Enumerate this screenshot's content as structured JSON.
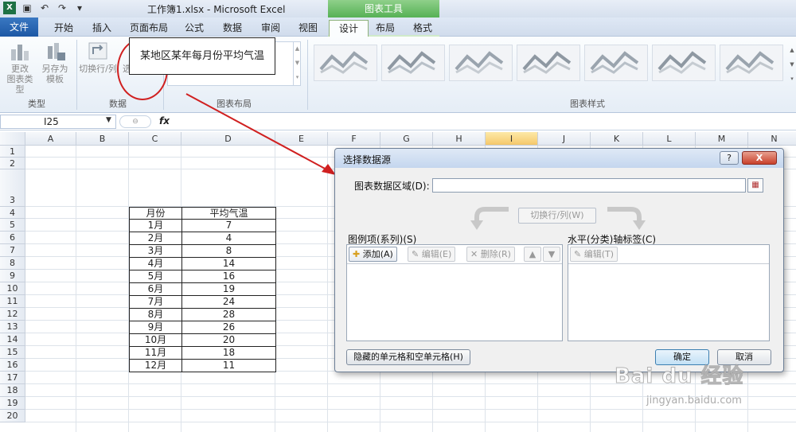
{
  "window": {
    "title": "工作簿1.xlsx  -  Microsoft Excel",
    "context_tab_group": "图表工具"
  },
  "tabs": [
    "文件",
    "开始",
    "插入",
    "页面布局",
    "公式",
    "数据",
    "审阅",
    "视图",
    "设计",
    "布局",
    "格式"
  ],
  "active_tab": "设计",
  "ribbon": {
    "change_chart_type": "更改\n图表类型",
    "save_as_template": "另存为\n模板",
    "switch_row_col": "切换行/列",
    "select_data": "选择数据",
    "group_type": "类型",
    "group_data": "数据",
    "group_chart_layouts": "图表布局",
    "group_chart_styles": "图表样式"
  },
  "formula_bar": {
    "name_box": "I25",
    "fx_label": "fx",
    "formula": ""
  },
  "sheet": {
    "columns": [
      "A",
      "B",
      "C",
      "D",
      "E",
      "F",
      "G",
      "H",
      "I",
      "J",
      "K",
      "L",
      "M",
      "N"
    ],
    "selected_column": "I",
    "rows": [
      "1",
      "2",
      "3",
      "4",
      "5",
      "6",
      "7",
      "8",
      "9",
      "10",
      "11",
      "12",
      "13",
      "14",
      "15",
      "16",
      "17",
      "18",
      "19",
      "20"
    ],
    "table_title": "某地区某年每月份平均气温",
    "header": [
      "月份",
      "平均气温"
    ],
    "data": [
      [
        "1月",
        "7"
      ],
      [
        "2月",
        "4"
      ],
      [
        "3月",
        "8"
      ],
      [
        "4月",
        "14"
      ],
      [
        "5月",
        "16"
      ],
      [
        "6月",
        "19"
      ],
      [
        "7月",
        "24"
      ],
      [
        "8月",
        "28"
      ],
      [
        "9月",
        "26"
      ],
      [
        "10月",
        "20"
      ],
      [
        "11月",
        "18"
      ],
      [
        "12月",
        "11"
      ]
    ]
  },
  "dialog": {
    "title": "选择数据源",
    "help": "?",
    "close": "X",
    "range_label": "图表数据区域(D):",
    "range_value": "",
    "switch_button": "切换行/列(W)",
    "series_label": "图例项(系列)(S)",
    "axis_label": "水平(分类)轴标签(C)",
    "add": "添加(A)",
    "edit": "编辑(E)",
    "delete": "删除(R)",
    "axis_edit": "编辑(T)",
    "hidden_cells": "隐藏的单元格和空单元格(H)",
    "ok": "确定",
    "cancel": "取消"
  },
  "watermark": {
    "text": "Bai du 经验",
    "url": "jingyan.baidu.com"
  },
  "colors": {
    "file_tab": "#2a6ab8",
    "context_green": "#56b155",
    "annotation_red": "#d02020"
  }
}
